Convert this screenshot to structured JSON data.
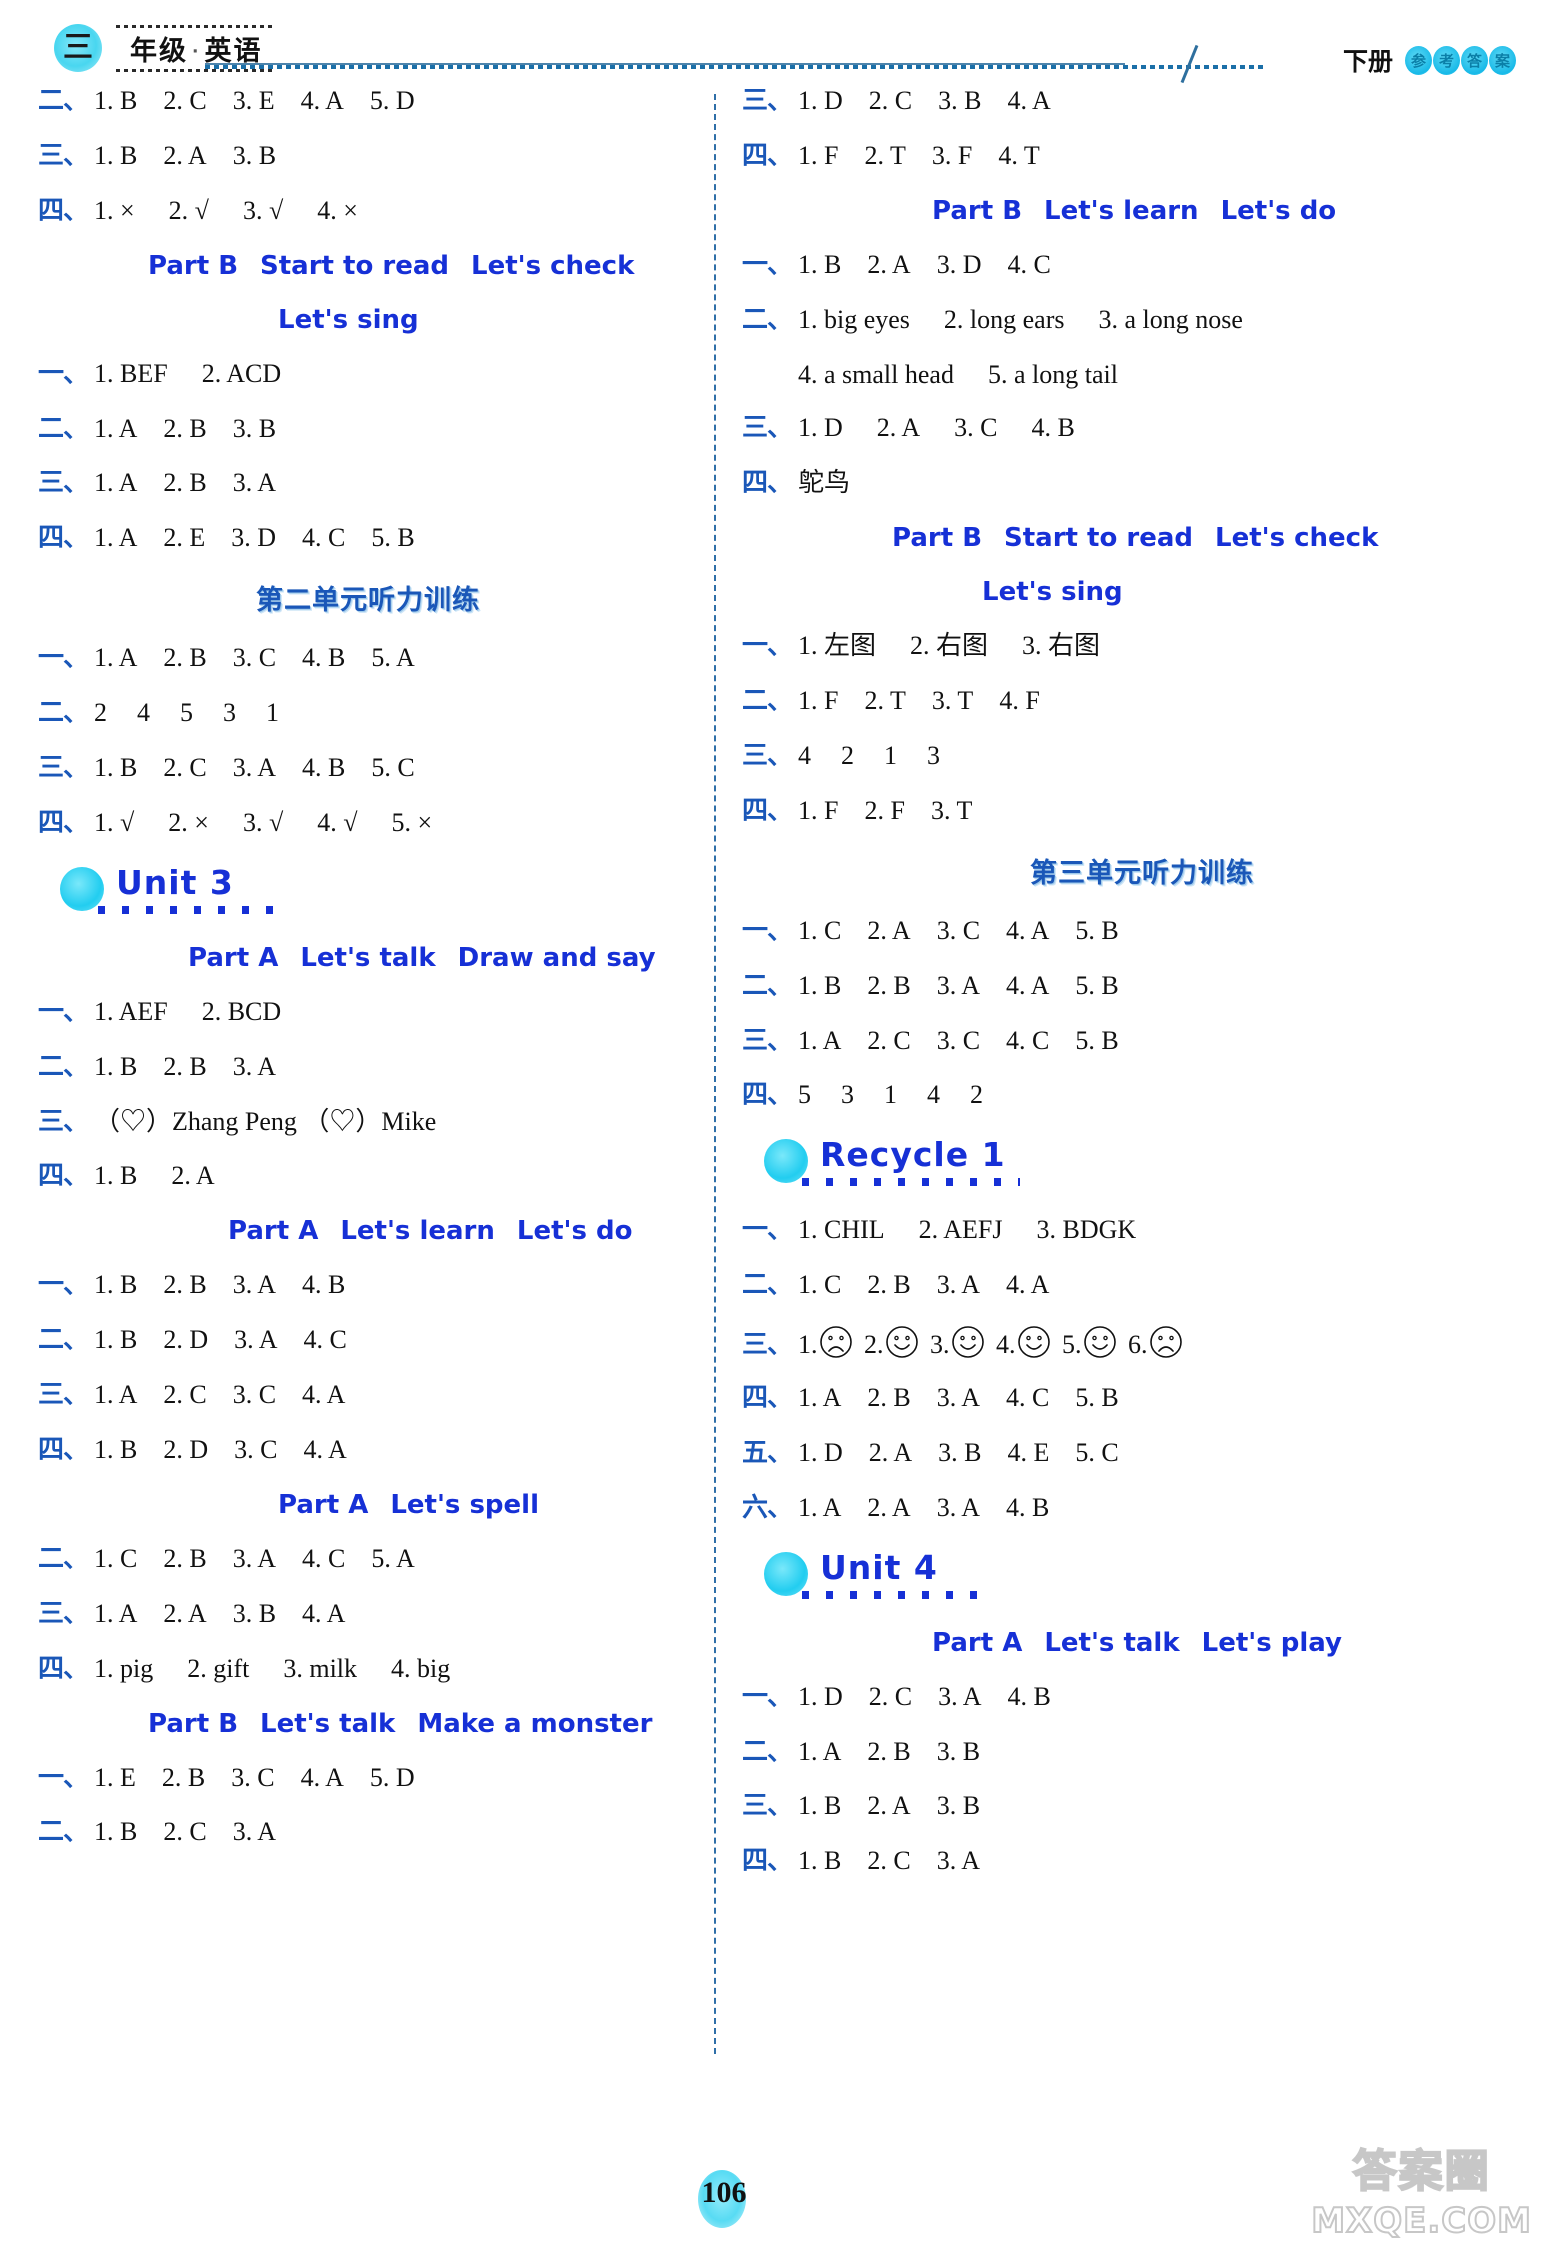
{
  "header": {
    "grade_char": "三",
    "title": "年级",
    "dot": "·",
    "subject": "英语",
    "volume": "下册",
    "answer_key_chars": [
      "参",
      "考",
      "答",
      "案"
    ]
  },
  "footer": {
    "page_number": "106",
    "watermark_cn": "答案圈",
    "watermark_url": "MXQE.COM"
  },
  "left": {
    "b1": {
      "n": "二、",
      "items": [
        "1. B",
        "2. C",
        "3. E",
        "4. A",
        "5. D"
      ]
    },
    "b2": {
      "n": "三、",
      "items": [
        "1. B",
        "2. A",
        "3. B"
      ]
    },
    "b3": {
      "n": "四、",
      "items": [
        "1. ×",
        "2. √",
        "3. √",
        "4. ×"
      ]
    },
    "h1": [
      "Part B",
      "Start to read",
      "Let's check"
    ],
    "h2": [
      "Let's sing"
    ],
    "b4": {
      "n": "一、",
      "items": [
        "1. BEF",
        "2. ACD"
      ]
    },
    "b5": {
      "n": "二、",
      "items": [
        "1. A",
        "2. B",
        "3. B"
      ]
    },
    "b6": {
      "n": "三、",
      "items": [
        "1. A",
        "2. B",
        "3. A"
      ]
    },
    "b7": {
      "n": "四、",
      "items": [
        "1. A",
        "2. E",
        "3. D",
        "4. C",
        "5. B"
      ]
    },
    "u2_listen": "第二单元听力训练",
    "b8": {
      "n": "一、",
      "items": [
        "1. A",
        "2. B",
        "3. C",
        "4. B",
        "5. A"
      ]
    },
    "b9": {
      "n": "二、",
      "items": [
        "2",
        "4",
        "5",
        "3",
        "1"
      ]
    },
    "b10": {
      "n": "三、",
      "items": [
        "1. B",
        "2. C",
        "3. A",
        "4. B",
        "5. C"
      ]
    },
    "b11": {
      "n": "四、",
      "items": [
        "1. √",
        "2. ×",
        "3. √",
        "4. √",
        "5. ×"
      ]
    },
    "unit3": "Unit  3",
    "h3": [
      "Part A",
      "Let's talk",
      "Draw and say"
    ],
    "b12": {
      "n": "一、",
      "items": [
        "1. AEF",
        "2. BCD"
      ]
    },
    "b13": {
      "n": "二、",
      "items": [
        "1. B",
        "2. B",
        "3. A"
      ]
    },
    "b14": {
      "n": "三、",
      "text": "（♡）Zhang Peng  （♡）Mike"
    },
    "b15": {
      "n": "四、",
      "items": [
        "1. B",
        "2. A"
      ]
    },
    "h4": [
      "Part A",
      "Let's learn",
      "Let's do"
    ],
    "b16": {
      "n": "一、",
      "items": [
        "1. B",
        "2. B",
        "3. A",
        "4. B"
      ]
    },
    "b17": {
      "n": "二、",
      "items": [
        "1. B",
        "2. D",
        "3. A",
        "4. C"
      ]
    },
    "b18": {
      "n": "三、",
      "items": [
        "1. A",
        "2. C",
        "3. C",
        "4. A"
      ]
    },
    "b19": {
      "n": "四、",
      "items": [
        "1. B",
        "2. D",
        "3. C",
        "4. A"
      ]
    },
    "h5": [
      "Part A",
      "Let's spell"
    ],
    "b20": {
      "n": "二、",
      "items": [
        "1. C",
        "2. B",
        "3. A",
        "4. C",
        "5. A"
      ]
    },
    "b21": {
      "n": "三、",
      "items": [
        "1. A",
        "2. A",
        "3. B",
        "4. A"
      ]
    },
    "b22": {
      "n": "四、",
      "items": [
        "1. pig",
        "2. gift",
        "3. milk",
        "4. big"
      ]
    },
    "h6": [
      "Part B",
      "Let's talk",
      "Make a monster"
    ],
    "b23": {
      "n": "一、",
      "items": [
        "1. E",
        "2. B",
        "3. C",
        "4. A",
        "5. D"
      ]
    },
    "b24": {
      "n": "二、",
      "items": [
        "1. B",
        "2. C",
        "3. A"
      ]
    }
  },
  "right": {
    "r1": {
      "n": "三、",
      "items": [
        "1. D",
        "2. C",
        "3. B",
        "4. A"
      ]
    },
    "r2": {
      "n": "四、",
      "items": [
        "1. F",
        "2. T",
        "3. F",
        "4. T"
      ]
    },
    "h1": [
      "Part B",
      "Let's learn",
      "Let's do"
    ],
    "r3": {
      "n": "一、",
      "items": [
        "1. B",
        "2. A",
        "3. D",
        "4. C"
      ]
    },
    "r4": {
      "n": "二、",
      "items": [
        "1. big eyes",
        "2. long ears",
        "3. a long nose"
      ]
    },
    "r4b": {
      "items": [
        "4. a small head",
        "5. a long tail"
      ]
    },
    "r5": {
      "n": "三、",
      "items": [
        "1. D",
        "2. A",
        "3. C",
        "4. B"
      ]
    },
    "r6": {
      "n": "四、",
      "items": [
        "鸵鸟"
      ]
    },
    "h2": [
      "Part B",
      "Start to read",
      "Let's check"
    ],
    "h3": [
      "Let's sing"
    ],
    "r7": {
      "n": "一、",
      "items": [
        "1. 左图",
        "2. 右图",
        "3. 右图"
      ]
    },
    "r8": {
      "n": "二、",
      "items": [
        "1. F",
        "2. T",
        "3. T",
        "4. F"
      ]
    },
    "r9": {
      "n": "三、",
      "items": [
        "4",
        "2",
        "1",
        "3"
      ]
    },
    "r10": {
      "n": "四、",
      "items": [
        "1. F",
        "2. F",
        "3. T"
      ]
    },
    "u3_listen": "第三单元听力训练",
    "r11": {
      "n": "一、",
      "items": [
        "1. C",
        "2. A",
        "3. C",
        "4. A",
        "5. B"
      ]
    },
    "r12": {
      "n": "二、",
      "items": [
        "1. B",
        "2. B",
        "3. A",
        "4. A",
        "5. B"
      ]
    },
    "r13": {
      "n": "三、",
      "items": [
        "1. A",
        "2. C",
        "3. C",
        "4. C",
        "5. B"
      ]
    },
    "r14": {
      "n": "四、",
      "items": [
        "5",
        "3",
        "1",
        "4",
        "2"
      ]
    },
    "recycle1": "Recycle  1",
    "r15": {
      "n": "一、",
      "items": [
        "1. CHIL",
        "2. AEFJ",
        "3. BDGK"
      ]
    },
    "r16": {
      "n": "二、",
      "items": [
        "1. C",
        "2. B",
        "3. A",
        "4. A"
      ]
    },
    "r17": {
      "n": "三、",
      "faces": [
        "sad",
        "happy",
        "happy",
        "happy",
        "happy",
        "sad"
      ],
      "labels": [
        "1.",
        "2.",
        "3.",
        "4.",
        "5.",
        "6."
      ]
    },
    "r18": {
      "n": "四、",
      "items": [
        "1. A",
        "2. B",
        "3. A",
        "4. C",
        "5. B"
      ]
    },
    "r19": {
      "n": "五、",
      "items": [
        "1. D",
        "2. A",
        "3. B",
        "4. E",
        "5. C"
      ]
    },
    "r20": {
      "n": "六、",
      "items": [
        "1. A",
        "2. A",
        "3. A",
        "4. B"
      ]
    },
    "unit4": "Unit  4",
    "h4": [
      "Part A",
      "Let's talk",
      "Let's play"
    ],
    "r21": {
      "n": "一、",
      "items": [
        "1. D",
        "2. C",
        "3. A",
        "4. B"
      ]
    },
    "r22": {
      "n": "二、",
      "items": [
        "1. A",
        "2. B",
        "3. B"
      ]
    },
    "r23": {
      "n": "三、",
      "items": [
        "1. B",
        "2. A",
        "3. B"
      ]
    },
    "r24": {
      "n": "四、",
      "items": [
        "1. B",
        "2. C",
        "3. A"
      ]
    }
  },
  "colors": {
    "accent_blue": "#1630d6",
    "num_blue": "#1a57b8",
    "cyan": "#22cdf0"
  }
}
